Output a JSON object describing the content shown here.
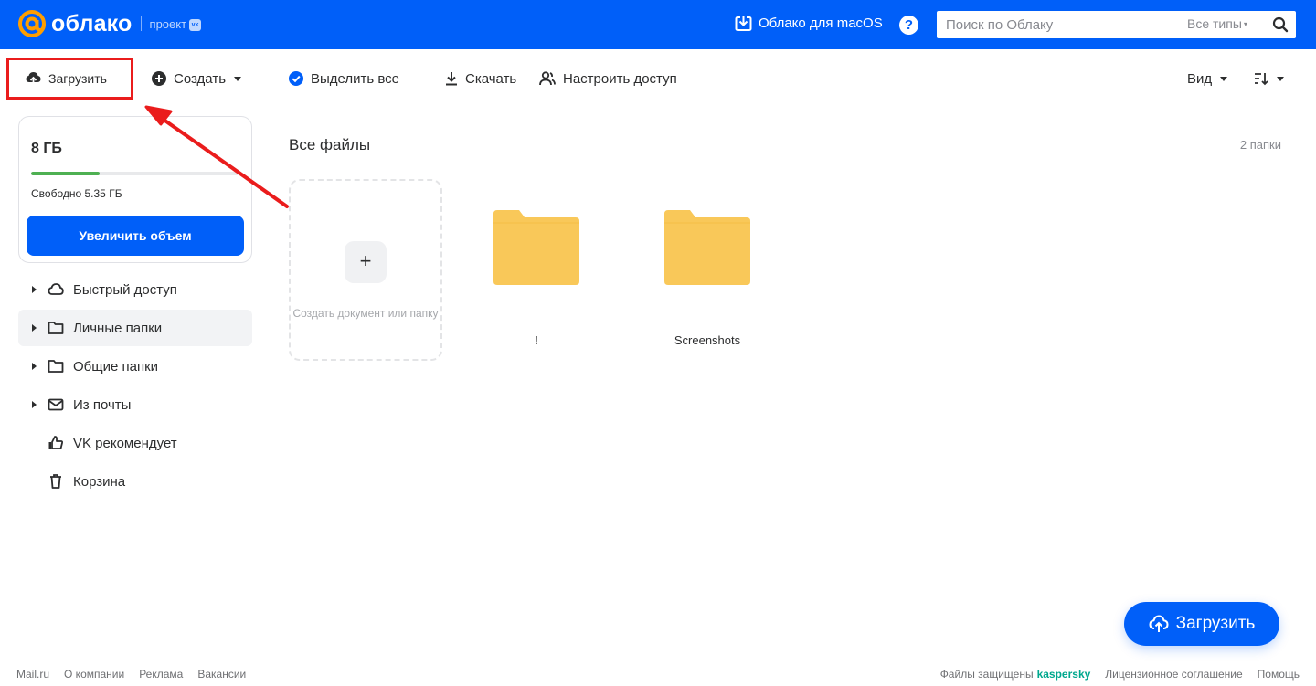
{
  "header": {
    "logo_text": "облако",
    "logo_project": "проект",
    "logo_vk": "vk",
    "mac_link": "Облако для macOS",
    "help_label": "?",
    "search_placeholder": "Поиск по Облаку",
    "types_label": "Все типы",
    "types_caret": "▾"
  },
  "toolbar": {
    "upload": "Загрузить",
    "create": "Создать",
    "select_all": "Выделить все",
    "download": "Скачать",
    "access": "Настроить доступ",
    "view": "Вид"
  },
  "storage": {
    "size": "8 ГБ",
    "used_fraction": 0.33,
    "free": "Свободно 5.35 ГБ",
    "increase_button": "Увеличить объем"
  },
  "sidebar": {
    "items": [
      {
        "label": "Быстрый доступ",
        "icon": "cloud-icon",
        "arrow": true
      },
      {
        "label": "Личные папки",
        "icon": "folder-icon",
        "arrow": true,
        "active": true
      },
      {
        "label": "Общие папки",
        "icon": "shared-folder-icon",
        "arrow": true
      },
      {
        "label": "Из почты",
        "icon": "mail-icon",
        "arrow": true
      },
      {
        "label": "VK рекомендует",
        "icon": "thumb-up-icon",
        "arrow": false
      },
      {
        "label": "Корзина",
        "icon": "trash-icon",
        "arrow": false
      }
    ]
  },
  "main": {
    "title": "Все файлы",
    "count": "2 папки",
    "create_card_plus": "+",
    "create_card_text": "Создать документ или папку",
    "folders": [
      {
        "name": "!"
      },
      {
        "name": "Screenshots"
      }
    ]
  },
  "fab": {
    "label": "Загрузить"
  },
  "footer": {
    "left": [
      "Mail.ru",
      "О компании",
      "Реклама",
      "Вакансии"
    ],
    "protected": "Файлы защищены",
    "kaspersky": "kaspersky",
    "right": [
      "Лицензионное соглашение",
      "Помощь"
    ]
  },
  "colors": {
    "brand_blue": "#005ff9",
    "logo_orange": "#ff9e00",
    "folder_yellow": "#f9c859",
    "storage_green": "#4eb052",
    "highlight_red": "#ea1c1c"
  }
}
